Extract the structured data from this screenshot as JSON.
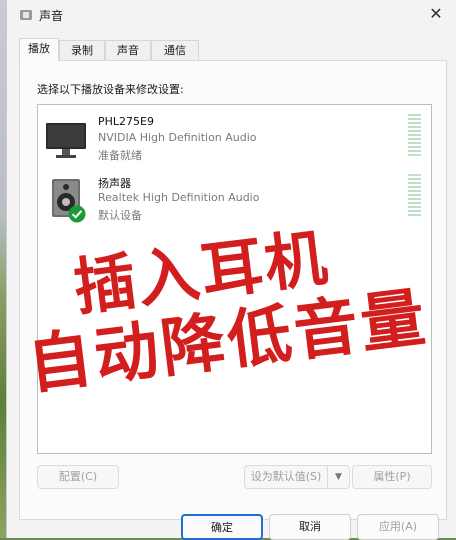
{
  "window": {
    "title": "声音"
  },
  "tabs": [
    {
      "label": "播放",
      "active": true
    },
    {
      "label": "录制",
      "active": false
    },
    {
      "label": "声音",
      "active": false
    },
    {
      "label": "通信",
      "active": false
    }
  ],
  "playback": {
    "instruction": "选择以下播放设备来修改设置:",
    "devices": [
      {
        "name": "PHL275E9",
        "description": "NVIDIA High Definition Audio",
        "status": "准备就绪",
        "icon": "monitor-icon",
        "default": false
      },
      {
        "name": "扬声器",
        "description": "Realtek High Definition Audio",
        "status": "默认设备",
        "icon": "speaker-icon",
        "default": true
      }
    ],
    "buttons": {
      "configure": "配置(C)",
      "set_default": "设为默认值(S)",
      "properties": "属性(P)"
    }
  },
  "overlay": {
    "line1": "插入耳机",
    "line2": "自动降低音量"
  },
  "footer": {
    "ok": "确定",
    "cancel": "取消",
    "apply": "应用(A)"
  },
  "colors": {
    "overlay_red": "#d31e1e",
    "accent_blue": "#1e6fd9",
    "default_check": "#1a9b3a"
  }
}
